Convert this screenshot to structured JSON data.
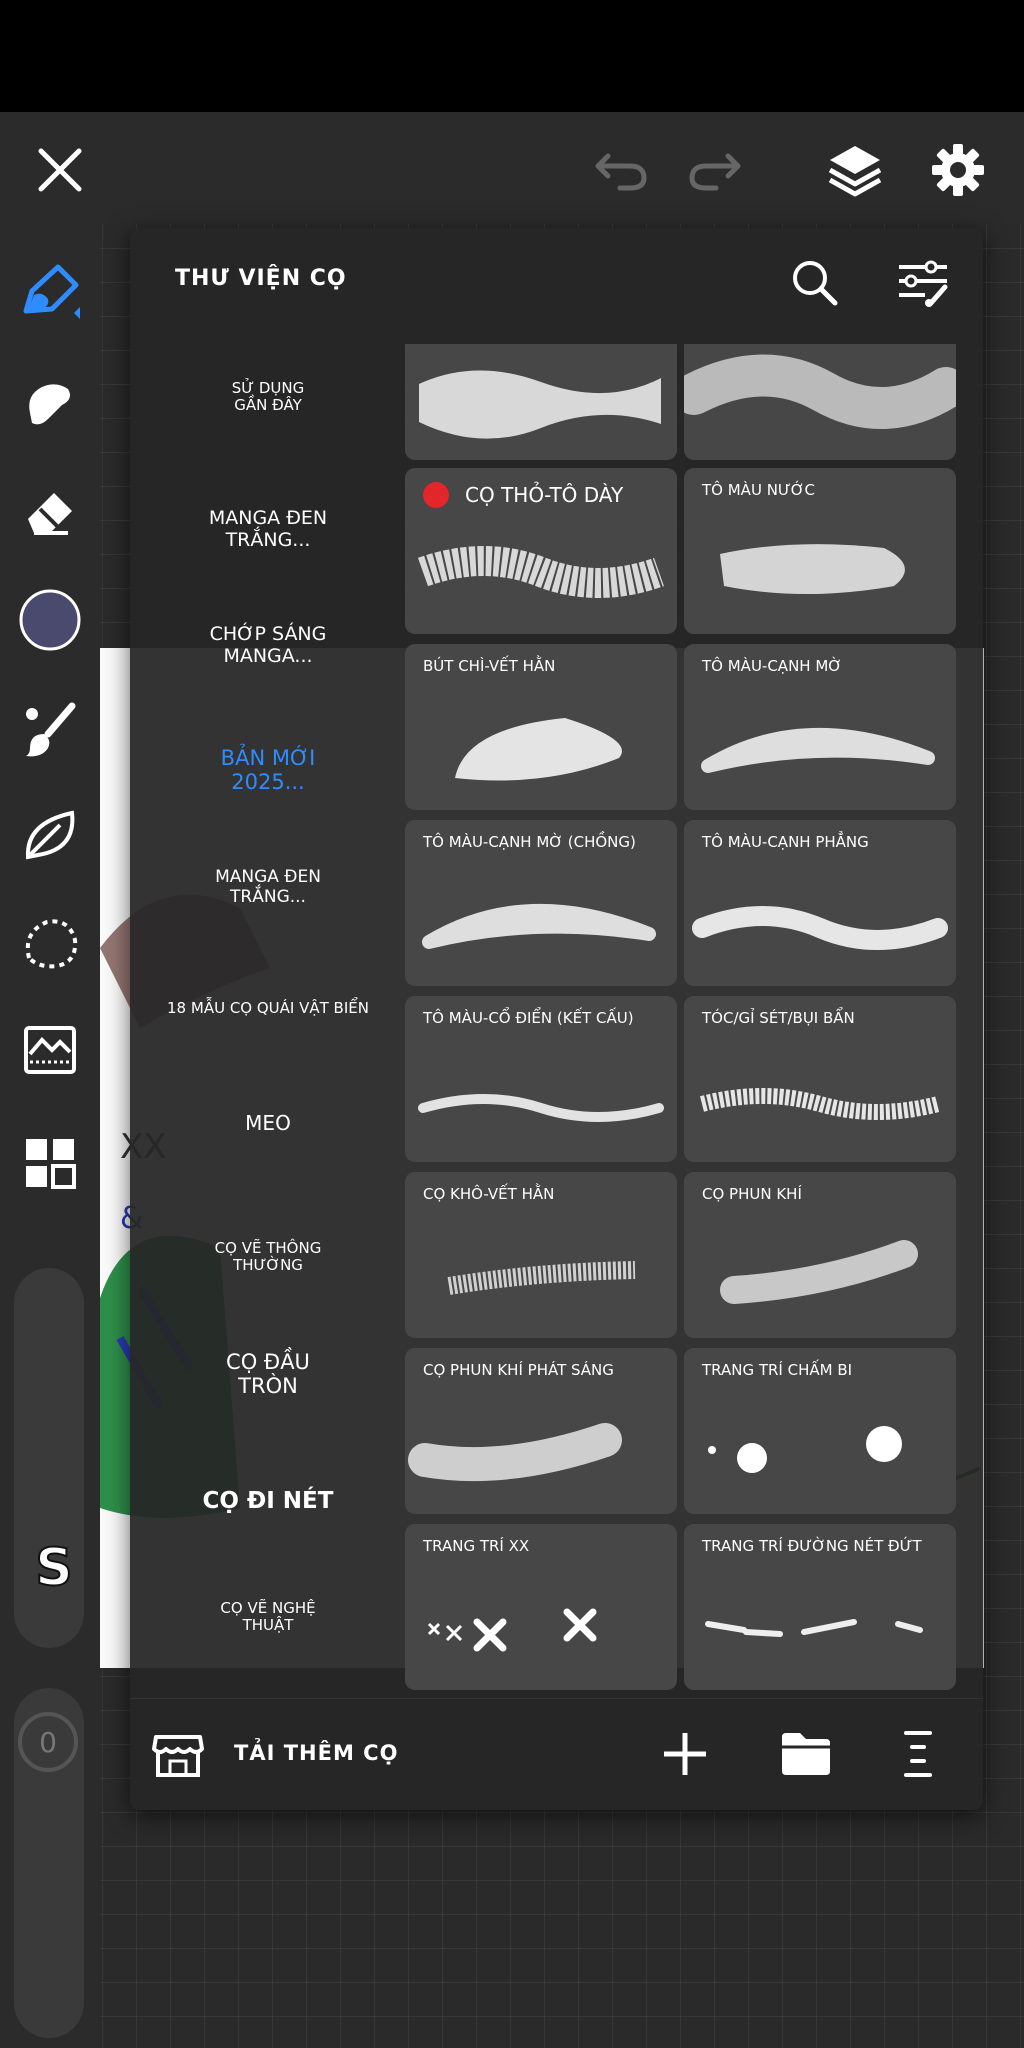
{
  "panel": {
    "title": "THƯ VIỆN CỌ",
    "footer_label": "TẢI THÊM CỌ"
  },
  "categories": [
    {
      "label": "SỬ DỤNG GẦN ĐÂY",
      "selected": false
    },
    {
      "label": "MANGA ĐEN TRẮNG...",
      "selected": false
    },
    {
      "label": "CHỚP SÁNG MANGA...",
      "selected": false
    },
    {
      "label": "BẢN MỚI 2025...",
      "selected": true
    },
    {
      "label": "MANGA ĐEN TRẮNG...",
      "selected": false
    },
    {
      "label": "18 MẪU CỌ QUÁI VẬT BIỂN",
      "selected": false
    },
    {
      "label": "MEO",
      "selected": false
    },
    {
      "label": "CỌ VẼ THÔNG THƯỜNG",
      "selected": false
    },
    {
      "label": "CỌ ĐẦU TRÒN",
      "selected": false
    },
    {
      "label": "CỌ ĐI NÉT",
      "selected": false
    },
    {
      "label": "CỌ VẼ NGHỆ THUẬT",
      "selected": false
    }
  ],
  "brushes": [
    {
      "label": "",
      "style": "textured"
    },
    {
      "label": "",
      "style": "soft"
    },
    {
      "label": "CỌ THỎ-TÔ DÀY",
      "style": "rough",
      "badge": "heart"
    },
    {
      "label": "TÔ MÀU NƯỚC",
      "style": "blob"
    },
    {
      "label": "BÚT CHÌ-VẾT HẰN",
      "style": "cloud"
    },
    {
      "label": "TÔ MÀU-CẠNH MỜ",
      "style": "leaf"
    },
    {
      "label": "TÔ MÀU-CẠNH MỜ (CHỒNG)",
      "style": "leaf"
    },
    {
      "label": "TÔ MÀU-CẠNH PHẲNG",
      "style": "wave"
    },
    {
      "label": "TÔ MÀU-CỔ ĐIỂN (KẾT CẤU)",
      "style": "thin"
    },
    {
      "label": "TÓC/GỈ SÉT/BỤI BẨN",
      "style": "grit"
    },
    {
      "label": "CỌ KHÔ-VẾT HẰN",
      "style": "dry"
    },
    {
      "label": "CỌ PHUN KHÍ",
      "style": "air"
    },
    {
      "label": "CỌ PHUN KHÍ PHÁT SÁNG",
      "style": "glow"
    },
    {
      "label": "TRANG TRÍ CHẤM BI",
      "style": "dots"
    },
    {
      "label": "TRANG TRÍ XX",
      "style": "xx"
    },
    {
      "label": "TRANG TRÍ ĐƯỜNG NÉT ĐỨT",
      "style": "dash"
    }
  ],
  "tools": [
    "brush-pen-icon",
    "smudge-icon",
    "eraser-icon",
    "color-swatch",
    "paint-brush-icon",
    "leaf-icon",
    "lasso-icon",
    "filter-icon",
    "gallery-icon"
  ],
  "colors": {
    "current": "#4a4a6e",
    "accent": "#2f8cff"
  },
  "slider_badge": "S",
  "opacity_value": "0"
}
